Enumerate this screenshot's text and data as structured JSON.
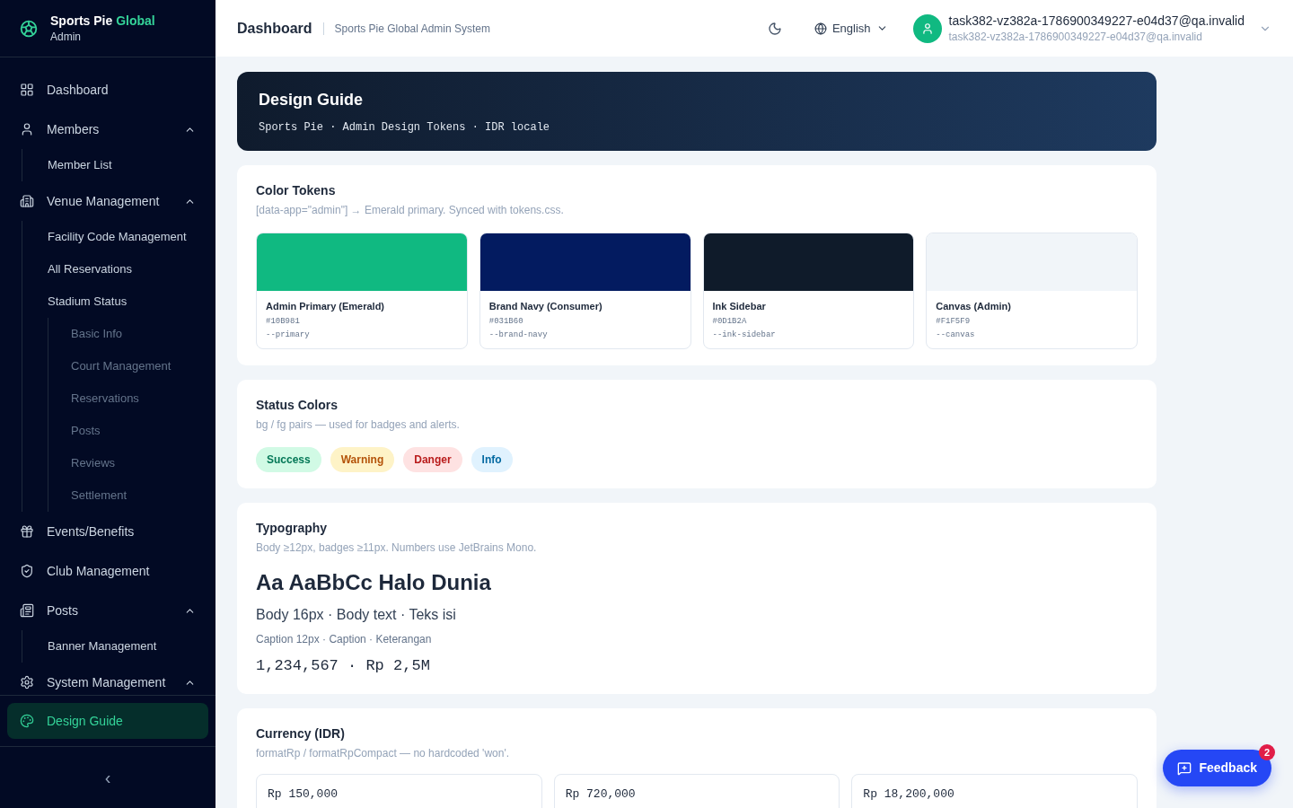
{
  "brand": {
    "name": "Sports Pie ",
    "accent": "Global",
    "subtitle": "Admin"
  },
  "sidebar": {
    "items": [
      {
        "label": "Dashboard",
        "selected": false
      },
      {
        "label": "Members",
        "selected": false,
        "expanded": true,
        "children": [
          {
            "label": "Member List",
            "selected": false
          }
        ]
      },
      {
        "label": "Venue Management",
        "selected": false,
        "expanded": true,
        "children": [
          {
            "label": "Facility Code Management",
            "selected": false
          },
          {
            "label": "All Reservations",
            "selected": false
          },
          {
            "label": "Stadium Status",
            "selected": false,
            "children": [
              {
                "label": "Basic Info",
                "selected": false
              },
              {
                "label": "Court Management",
                "selected": false
              },
              {
                "label": "Reservations",
                "selected": false
              },
              {
                "label": "Posts",
                "selected": false
              },
              {
                "label": "Reviews",
                "selected": false
              },
              {
                "label": "Settlement",
                "selected": false
              }
            ]
          }
        ]
      },
      {
        "label": "Events/Benefits",
        "selected": false
      },
      {
        "label": "Club Management",
        "selected": false
      },
      {
        "label": "Posts",
        "selected": false,
        "expanded": true,
        "children": [
          {
            "label": "Banner Management",
            "selected": false
          }
        ]
      },
      {
        "label": "System Management",
        "selected": false,
        "expanded": true
      }
    ],
    "footer_item": {
      "label": "Design Guide",
      "selected": true
    },
    "collapse": "‹"
  },
  "header": {
    "title": "Dashboard",
    "subtitle": "Sports Pie Global Admin System",
    "language": "English",
    "user": {
      "name": "task382-vz382a-1786900349227-e04d37@qa.invalid",
      "email": "task382-vz382a-1786900349227-e04d37@qa.invalid"
    }
  },
  "banner": {
    "title": "Design Guide",
    "subtitle": "Sports Pie · Admin Design Tokens · IDR locale"
  },
  "color_tokens": {
    "title": "Color Tokens",
    "description": "[data-app=\"admin\"] → Emerald primary. Synced with tokens.css.",
    "items": [
      {
        "name": "Admin Primary (Emerald)",
        "hex": "#10B981",
        "variable": "--primary",
        "color": "#10b981"
      },
      {
        "name": "Brand Navy (Consumer)",
        "hex": "#031B60",
        "variable": "--brand-navy",
        "color": "#031b60"
      },
      {
        "name": "Ink Sidebar",
        "hex": "#0D1B2A",
        "variable": "--ink-sidebar",
        "color": "#0f1b2a"
      },
      {
        "name": "Canvas (Admin)",
        "hex": "#F1F5F9",
        "variable": "--canvas",
        "color": "#f1f5f9"
      }
    ]
  },
  "status_colors": {
    "title": "Status Colors",
    "description": "bg / fg pairs — used for badges and alerts.",
    "badges": [
      {
        "label": "Success",
        "kind": "success"
      },
      {
        "label": "Warning",
        "kind": "warning"
      },
      {
        "label": "Danger",
        "kind": "danger"
      },
      {
        "label": "Info",
        "kind": "info"
      }
    ]
  },
  "typography": {
    "title": "Typography",
    "description": "Body ≥12px, badges ≥11px. Numbers use JetBrains Mono.",
    "samples": [
      {
        "text": "Aa AaBbCc Halo Dunia",
        "kind": "display"
      },
      {
        "text": "Body 16px · Body text · Teks isi",
        "kind": "body"
      },
      {
        "text": "Caption 12px · Caption · Keterangan",
        "kind": "caption"
      },
      {
        "text": "1,234,567 · Rp 2,5M",
        "kind": "numeric"
      }
    ]
  },
  "currency": {
    "title": "Currency (IDR)",
    "description": "formatRp / formatRpCompact — no hardcoded 'won'.",
    "values": [
      "Rp 150,000",
      "Rp 720,000",
      "Rp 18,200,000"
    ]
  },
  "feedback": {
    "label": "Feedback",
    "count": "2"
  }
}
